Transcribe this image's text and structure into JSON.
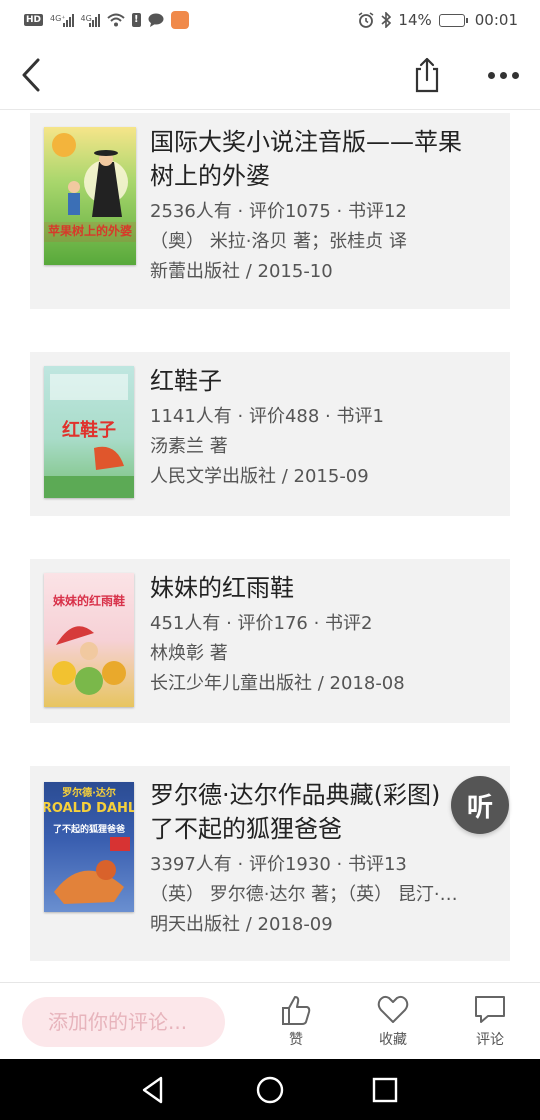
{
  "status_bar": {
    "hd_label": "HD",
    "signal1_tag": "4G⁺",
    "signal2_tag": "4G",
    "battery_percent": "14%",
    "battery_level": 0.14,
    "time": "00:01",
    "battery_color": "#f08a24"
  },
  "header": {
    "back_icon": "chevron-left-icon",
    "share_icon": "share-icon",
    "more_icon": "more-horizontal-icon"
  },
  "books": [
    {
      "title_line1": "国际大奖小说注音版——苹果",
      "title_line2": "树上的外婆",
      "stats": "2536人有 · 评价1075 · 书评12",
      "author": "（奥） 米拉·洛贝 著；张桂贞 译",
      "publisher": "新蕾出版社 / 2015-10",
      "cover_text": "苹果树上的外婆"
    },
    {
      "title_line1": "红鞋子",
      "stats": "1141人有 · 评价488 · 书评1",
      "author": "汤素兰 著",
      "publisher": "人民文学出版社 / 2015-09",
      "cover_text": "红鞋子"
    },
    {
      "title_line1": "妹妹的红雨鞋",
      "stats": "451人有 · 评价176 · 书评2",
      "author": "林焕彰 著",
      "publisher": "长江少年儿童出版社 / 2018-08",
      "cover_text": "妹妹的红雨鞋"
    },
    {
      "title_line1": "罗尔德·达尔作品典藏(彩图)",
      "title_line2": "了不起的狐狸爸爸",
      "stats": "3397人有 · 评价1930 · 书评13",
      "author": "（英） 罗尔德·达尔 著；（英） 昆汀·…",
      "publisher": "明天出版社 / 2018-09",
      "cover_text_top": "罗尔德·达尔",
      "cover_text_brand": "ROALD DAHL",
      "cover_text_title": "了不起的狐狸爸爸"
    }
  ],
  "listen_button": {
    "label": "听"
  },
  "bottom_bar": {
    "comment_placeholder": "添加你的评论...",
    "like_label": "赞",
    "favorite_label": "收藏",
    "comment_label": "评论",
    "placeholder_color": "#e7b4bc",
    "input_bg": "#fce7ea"
  },
  "nav_bar": {
    "back_icon": "triangle-back-icon",
    "home_icon": "circle-home-icon",
    "recents_icon": "square-recents-icon"
  }
}
